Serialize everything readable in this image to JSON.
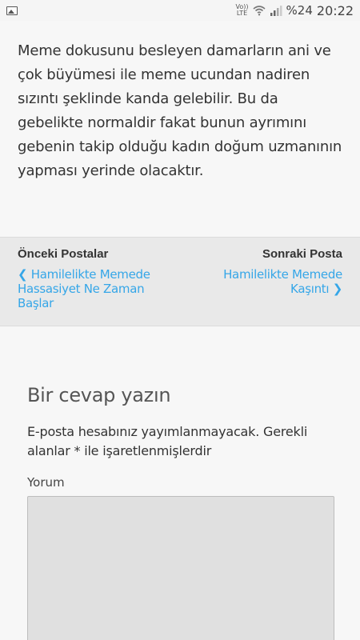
{
  "status_bar": {
    "network_top": "Vo))",
    "network_bottom": "LTE",
    "battery": "%24",
    "time": "20:22",
    "icons": [
      "image-icon",
      "wifi-icon",
      "signal-icon"
    ]
  },
  "article": {
    "paragraph": "Meme dokusunu besleyen damarların ani ve çok büyümesi ile meme ucundan nadiren sızıntı şeklinde kanda gelebilir. Bu da gebelikte normaldir fakat bunun ayrımını gebenin takip olduğu kadın doğum uzmanının yapması yerinde olacaktır."
  },
  "post_nav": {
    "prev_heading": "Önceki Postalar",
    "prev_link": "Hamilelikte Memede Hassasiyet Ne Zaman Başlar",
    "next_heading": "Sonraki Posta",
    "next_link": "Hamilelikte Memede Kaşıntı",
    "link_color": "#35a6e8"
  },
  "reply": {
    "title": "Bir cevap yazın",
    "notes": "E-posta hesabınız yayımlanmayacak. Gerekli alanlar * ile işaretlenmişlerdir",
    "comment_label": "Yorum",
    "comment_value": ""
  }
}
